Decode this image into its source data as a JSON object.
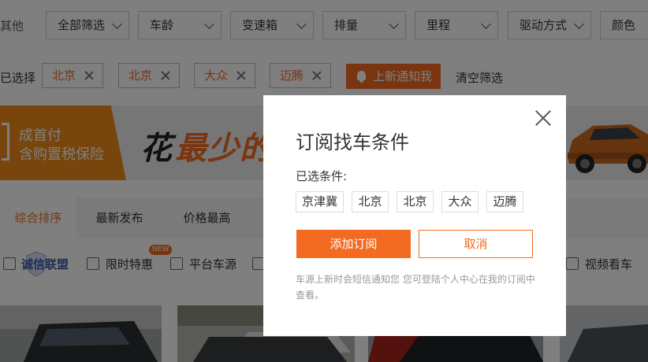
{
  "filters": {
    "other_label": "其他",
    "selects": [
      "全部筛选",
      "车龄",
      "变速箱",
      "排量",
      "里程",
      "驱动方式",
      "颜色"
    ]
  },
  "selected": {
    "label": "已选择",
    "tags": [
      "北京",
      "北京",
      "大众",
      "迈腾"
    ],
    "notify_label": "上新通知我",
    "clear_label": "清空筛选"
  },
  "banner": {
    "line1": "成首付",
    "line2": "含购置税保险",
    "big_a": "花",
    "big_b": "最少的"
  },
  "sort": {
    "tabs": [
      "综合排序",
      "最新发布",
      "价格最高"
    ]
  },
  "checks": {
    "brand": "诚信联盟",
    "items": [
      "限时特惠",
      "平台车源",
      "视频看车"
    ],
    "new_badge": "NEW"
  },
  "modal": {
    "title": "订阅找车条件",
    "subtitle": "已选条件:",
    "conditions": [
      "京津冀",
      "北京",
      "北京",
      "大众",
      "迈腾"
    ],
    "add_label": "添加订阅",
    "cancel_label": "取消",
    "note": "车源上新时会短信通知您 您可登陆个人中心在我的订阅中查看。"
  },
  "colors": {
    "accent": "#f36b21",
    "overlay": "rgba(0,0,0,0.5)"
  }
}
